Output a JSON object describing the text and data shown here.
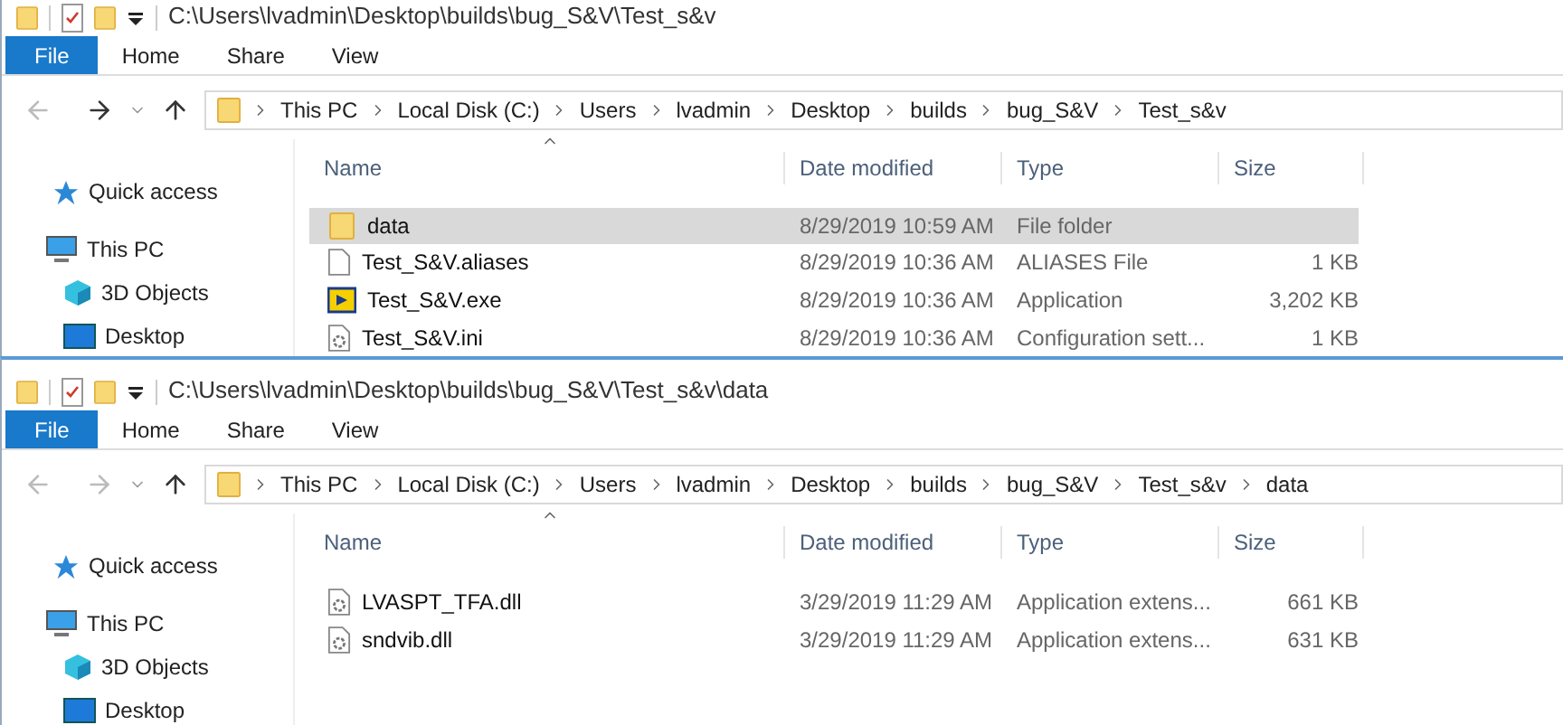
{
  "windows": [
    {
      "title": "C:\\Users\\lvadmin\\Desktop\\builds\\bug_S&V\\Test_s&v",
      "tabs": [
        {
          "label": "File",
          "kind": "file"
        },
        {
          "label": "Home",
          "kind": "tab"
        },
        {
          "label": "Share",
          "kind": "tab"
        },
        {
          "label": "View",
          "kind": "tab"
        }
      ],
      "back_disabled": true,
      "forward_disabled": false,
      "breadcrumbs": [
        "This PC",
        "Local Disk (C:)",
        "Users",
        "lvadmin",
        "Desktop",
        "builds",
        "bug_S&V",
        "Test_s&v"
      ],
      "sidebar": [
        {
          "label": "Quick access",
          "kind": "star"
        },
        {
          "label": "This PC",
          "kind": "pc"
        },
        {
          "label": "3D Objects",
          "kind": "cube"
        },
        {
          "label": "Desktop",
          "kind": "desktop"
        }
      ],
      "columns": [
        "Name",
        "Date modified",
        "Type",
        "Size"
      ],
      "rows": [
        {
          "kind": "folder",
          "name": "data",
          "date": "8/29/2019 10:59 AM",
          "type": "File folder",
          "selected": true
        },
        {
          "kind": "file",
          "name": "Test_S&V.aliases",
          "date": "8/29/2019 10:36 AM",
          "type": "ALIASES File",
          "size": "1 KB",
          "selected": false
        },
        {
          "kind": "exe",
          "name": "Test_S&V.exe",
          "date": "8/29/2019 10:36 AM",
          "type": "Application",
          "size": "3,202 KB",
          "selected": false
        },
        {
          "kind": "config",
          "name": "Test_S&V.ini",
          "date": "8/29/2019 10:36 AM",
          "type": "Configuration sett...",
          "size": "1 KB",
          "selected": false
        }
      ]
    },
    {
      "title": "C:\\Users\\lvadmin\\Desktop\\builds\\bug_S&V\\Test_s&v\\data",
      "tabs": [
        {
          "label": "File",
          "kind": "file"
        },
        {
          "label": "Home",
          "kind": "tab"
        },
        {
          "label": "Share",
          "kind": "tab"
        },
        {
          "label": "View",
          "kind": "tab"
        }
      ],
      "back_disabled": true,
      "forward_disabled": true,
      "breadcrumbs": [
        "This PC",
        "Local Disk (C:)",
        "Users",
        "lvadmin",
        "Desktop",
        "builds",
        "bug_S&V",
        "Test_s&v",
        "data"
      ],
      "sidebar": [
        {
          "label": "Quick access",
          "kind": "star"
        },
        {
          "label": "This PC",
          "kind": "pc"
        },
        {
          "label": "3D Objects",
          "kind": "cube"
        },
        {
          "label": "Desktop",
          "kind": "desktop"
        }
      ],
      "columns": [
        "Name",
        "Date modified",
        "Type",
        "Size"
      ],
      "rows": [
        {
          "kind": "dll",
          "name": "LVASPT_TFA.dll",
          "date": "3/29/2019 11:29 AM",
          "type": "Application extens...",
          "size": "661 KB",
          "selected": false
        },
        {
          "kind": "dll",
          "name": "sndvib.dll",
          "date": "3/29/2019 11:29 AM",
          "type": "Application extens...",
          "size": "631 KB",
          "selected": false
        }
      ]
    }
  ]
}
